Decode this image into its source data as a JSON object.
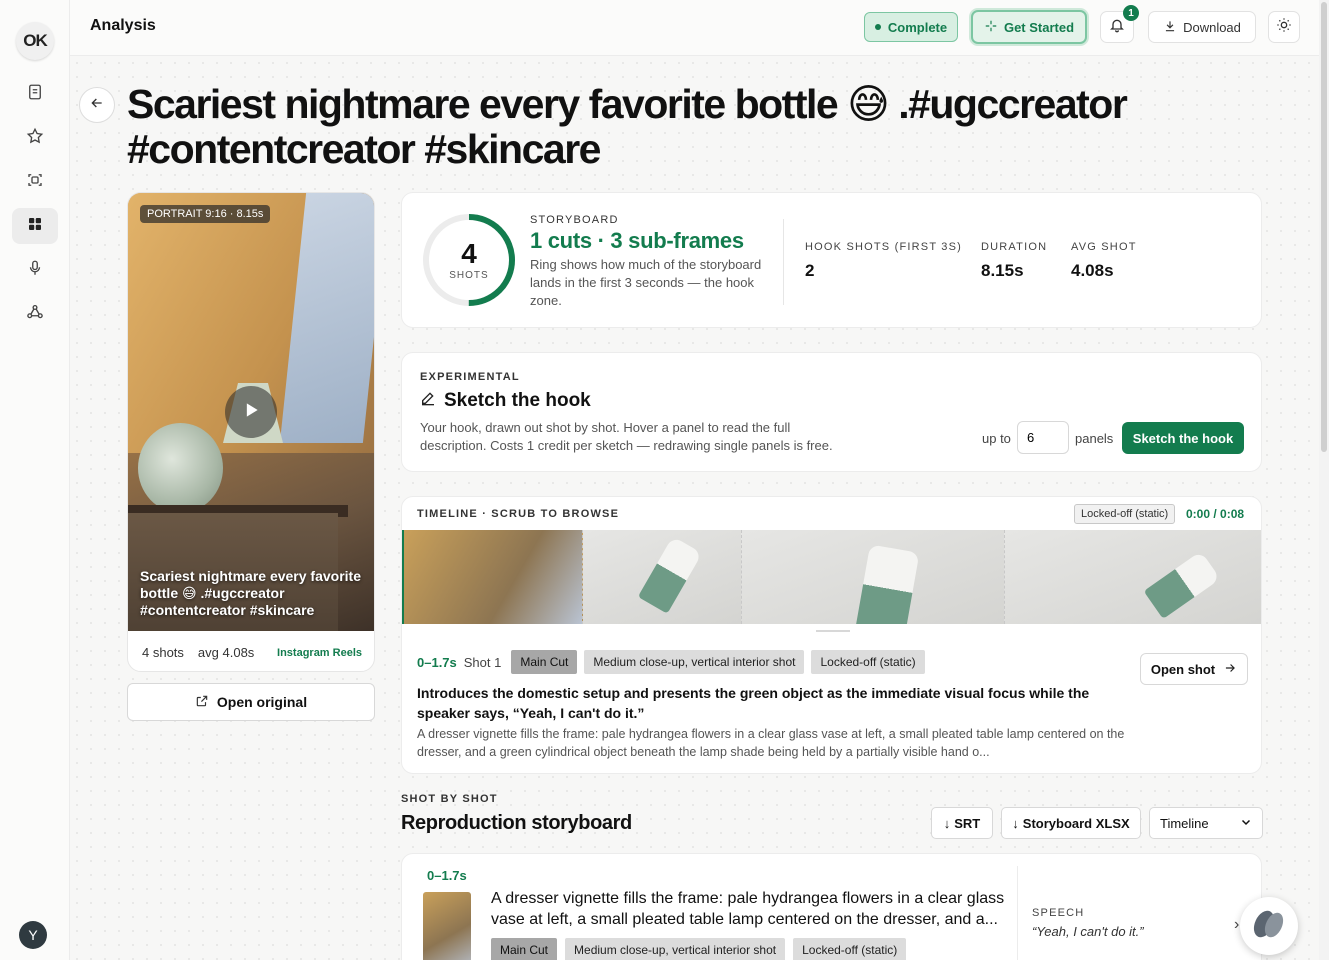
{
  "app": {
    "logo_text": "OK",
    "page_title": "Analysis",
    "user_initial": "Y"
  },
  "topbar": {
    "status": "Complete",
    "get_started": "Get Started",
    "notifications_count": "1",
    "download": "Download"
  },
  "sidebar": {
    "items": [
      {
        "icon": "notes-icon"
      },
      {
        "icon": "star-icon"
      },
      {
        "icon": "scan-icon"
      },
      {
        "icon": "grid-icon",
        "active": true
      },
      {
        "icon": "microphone-icon"
      },
      {
        "icon": "network-icon"
      }
    ]
  },
  "video": {
    "title": "Scariest nightmare every favorite bottle 😅 .#ugccreator #contentcreator #skincare",
    "portrait_chip": "PORTRAIT 9:16 · 8.15s",
    "caption": "Scariest nightmare every favorite bottle 😅 .#ugccreator #contentcreator #skincare",
    "shots_label": "4 shots",
    "avg_label": "avg 4.08s",
    "platform": "Instagram Reels",
    "open_original": "Open original"
  },
  "storyboard": {
    "ring_number": "4",
    "ring_label": "SHOTS",
    "ring_fraction": 0.5,
    "eyebrow": "STORYBOARD",
    "headline": "1 cuts · 3 sub-frames",
    "description": "Ring shows how much of the storyboard lands in the first 3 seconds — the hook zone.",
    "stats": [
      {
        "label": "HOOK SHOTS (FIRST 3S)",
        "value": "2"
      },
      {
        "label": "DURATION",
        "value": "8.15s"
      },
      {
        "label": "AVG SHOT",
        "value": "4.08s"
      }
    ]
  },
  "hook": {
    "eyebrow": "EXPERIMENTAL",
    "title": "Sketch the hook",
    "description": "Your hook, drawn out shot by shot. Hover a panel to read the full description. Costs 1 credit per sketch — redrawing single panels is free.",
    "up_to": "up to",
    "panels_value": "6",
    "panels_label": "panels",
    "button": "Sketch the hook"
  },
  "timeline": {
    "eyebrow": "TIMELINE · SCRUB TO BROWSE",
    "tooltip": "Locked-off (static)",
    "time": "0:00 / 0:08",
    "segments_fraction": [
      0.21,
      0.185,
      0.305,
      0.3
    ],
    "current": {
      "range": "0–1.7s",
      "shot": "Shot 1",
      "tags": [
        "Main Cut",
        "Medium close-up, vertical interior shot",
        "Locked-off (static)"
      ],
      "open_shot": "Open shot",
      "summary": "Introduces the domestic setup and presents the green object as the immediate visual focus while the speaker says, “Yeah, I can't do it.”",
      "detail": "A dresser vignette fills the frame: pale hydrangea flowers in a clear glass vase at left, a small pleated table lamp centered on the dresser, and a green cylindrical object beneath the lamp shade being held by a partially visible hand o..."
    }
  },
  "reproduction": {
    "eyebrow": "SHOT BY SHOT",
    "title": "Reproduction storyboard",
    "srt": "SRT",
    "xlsx": "Storyboard XLSX",
    "view_select": "Timeline",
    "shots": [
      {
        "range": "0–1.7s",
        "title": "A dresser vignette fills the frame: pale hydrangea flowers in a clear glass vase at left, a small pleated table lamp centered on the dresser, and a...",
        "tags": [
          "Main Cut",
          "Medium close-up, vertical interior shot",
          "Locked-off (static)"
        ],
        "speech_label": "SPEECH",
        "speech": "“Yeah, I can't do it.”"
      }
    ]
  },
  "colors": {
    "accent": "#137c4e",
    "accent_soft": "#d8efe2"
  }
}
